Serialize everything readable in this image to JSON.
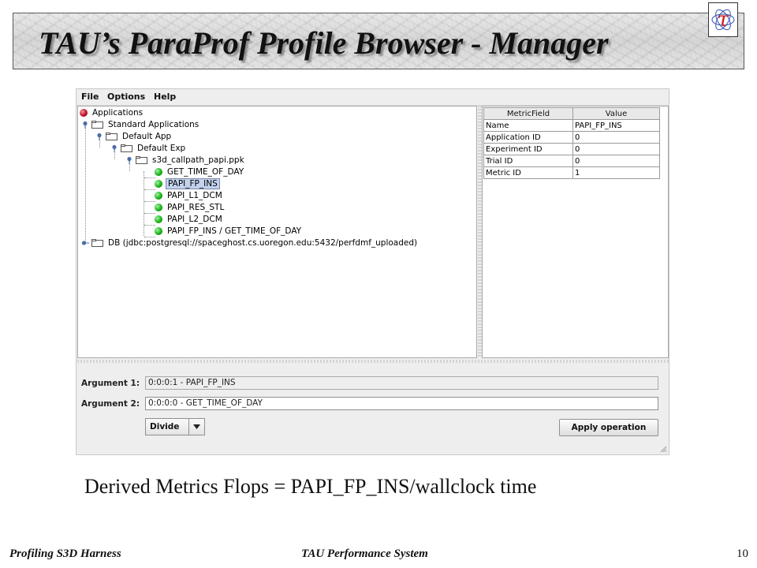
{
  "slide": {
    "title": "TAU’s ParaProf Profile Browser - Manager",
    "logo_glyph": "τ",
    "caption": "Derived Metrics Flops = PAPI_FP_INS/wallclock time",
    "footer_left": "Profiling S3D Harness",
    "footer_center": "TAU Performance System",
    "page_number": "10"
  },
  "menubar": {
    "items": [
      "File",
      "Options",
      "Help"
    ]
  },
  "tree": {
    "root": "Applications",
    "standard": "Standard Applications",
    "app": "Default App",
    "exp": "Default Exp",
    "trial": "s3d_callpath_papi.ppk",
    "metrics": [
      "GET_TIME_OF_DAY",
      "PAPI_FP_INS",
      "PAPI_L1_DCM",
      "PAPI_RES_STL",
      "PAPI_L2_DCM",
      "PAPI_FP_INS / GET_TIME_OF_DAY"
    ],
    "selected_metric": "PAPI_FP_INS",
    "db": "DB (jdbc:postgresql://spaceghost.cs.uoregon.edu:5432/perfdmf_uploaded)"
  },
  "table": {
    "columns": [
      "MetricField",
      "Value"
    ],
    "rows": [
      [
        "Name",
        "PAPI_FP_INS"
      ],
      [
        "Application ID",
        "0"
      ],
      [
        "Experiment ID",
        "0"
      ],
      [
        "Trial ID",
        "0"
      ],
      [
        "Metric ID",
        "1"
      ]
    ]
  },
  "operation": {
    "arg1_label": "Argument 1:",
    "arg1_value": "0:0:0:1 - PAPI_FP_INS",
    "arg2_label": "Argument 2:",
    "arg2_value": "0:0:0:0 - GET_TIME_OF_DAY",
    "operator": "Divide",
    "apply_label": "Apply operation"
  },
  "colors": {
    "selection": "#c3d3ee",
    "metric_ball": "#1bb21b",
    "root_ball": "#c0102a",
    "logo_tau": "#d01818"
  },
  "icons": {
    "metric_node": "green-ball-icon",
    "root_node": "red-ball-icon",
    "container_node": "folder-icon",
    "expand": "node-toggle-icon",
    "dropdown": "triangle-down-icon",
    "resize": "resize-grip-icon"
  }
}
